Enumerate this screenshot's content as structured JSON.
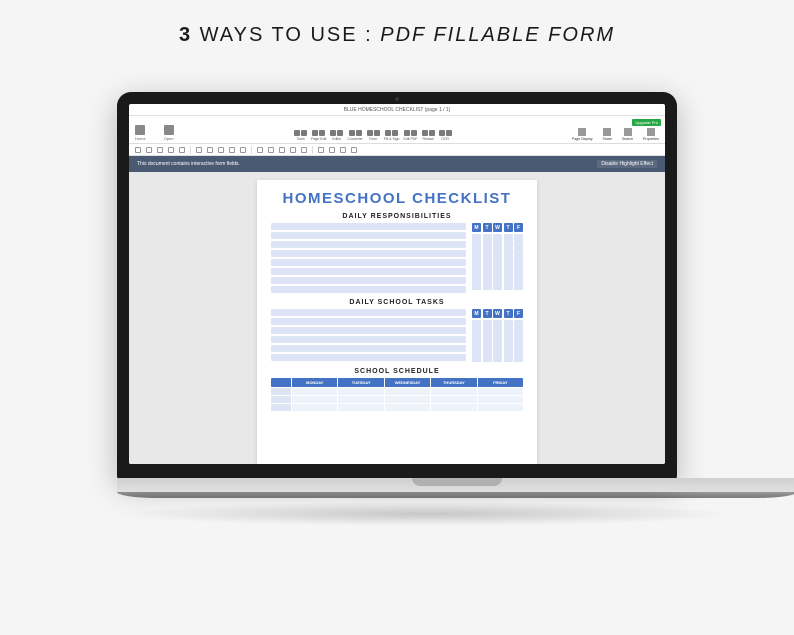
{
  "header": {
    "prefix_bold": "3",
    "prefix_light": " WAYS TO USE : ",
    "suffix_italic": "PDF FILLABLE FORM"
  },
  "app": {
    "title": "BLUE HOMESCHOOL CHECKLIST  (page 1 / 1)",
    "upgrade_label": "Upgrade Pro",
    "leftTools": [
      "Home",
      "Open"
    ],
    "centerGroups": [
      "Tools",
      "Page Edit",
      "Editor",
      "Converter",
      "Form",
      "Fill & Sign",
      "Edit PDF",
      "Redact",
      "OCR"
    ],
    "rightTools": [
      "Page Display",
      "Share",
      "Search",
      "Properties"
    ],
    "info_text": "This document contains interactive form fields.",
    "info_button": "Disable Highlight Effect"
  },
  "document": {
    "title": "HOMESCHOOL CHECKLIST",
    "section1": "DAILY RESPONSIBILITIES",
    "section2": "DAILY SCHOOL TASKS",
    "section3": "SCHOOL SCHEDULE",
    "days": [
      "M",
      "T",
      "W",
      "T",
      "F"
    ],
    "schedule_days": [
      "MONDAY",
      "TUESDAY",
      "WEDNESDAY",
      "THURSDAY",
      "FRIDAY"
    ],
    "section1_rows": 8,
    "section2_rows": 6,
    "schedule_rows": 3
  }
}
